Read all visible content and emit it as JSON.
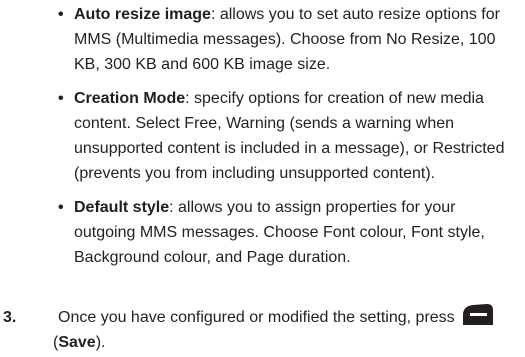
{
  "bullets": [
    {
      "mark": "•",
      "term": "Auto resize image",
      "text": ": allows you to set auto resize options for MMS (Multimedia messages). Choose from No Resize, 100 KB, 300 KB and 600 KB image size."
    },
    {
      "mark": "•",
      "term": "Creation Mode",
      "text": ": specify options for creation of new media content. Select Free, Warning (sends a warning when unsupported content is included in a message), or Restricted (prevents you from including unsupported content)."
    },
    {
      "mark": "•",
      "term": "Default style",
      "text": ": allows you to assign properties for your outgoing MMS messages. Choose Font colour, Font style, Background colour, and Page duration."
    }
  ],
  "step": {
    "number": "3.",
    "text": "Once you have configured or modified the setting, press",
    "icon": "left-softkey-icon",
    "open_paren": "(",
    "action": "Save",
    "close_paren": ")."
  },
  "colors": {
    "text": "#231f20",
    "softkey": "#231f20"
  }
}
